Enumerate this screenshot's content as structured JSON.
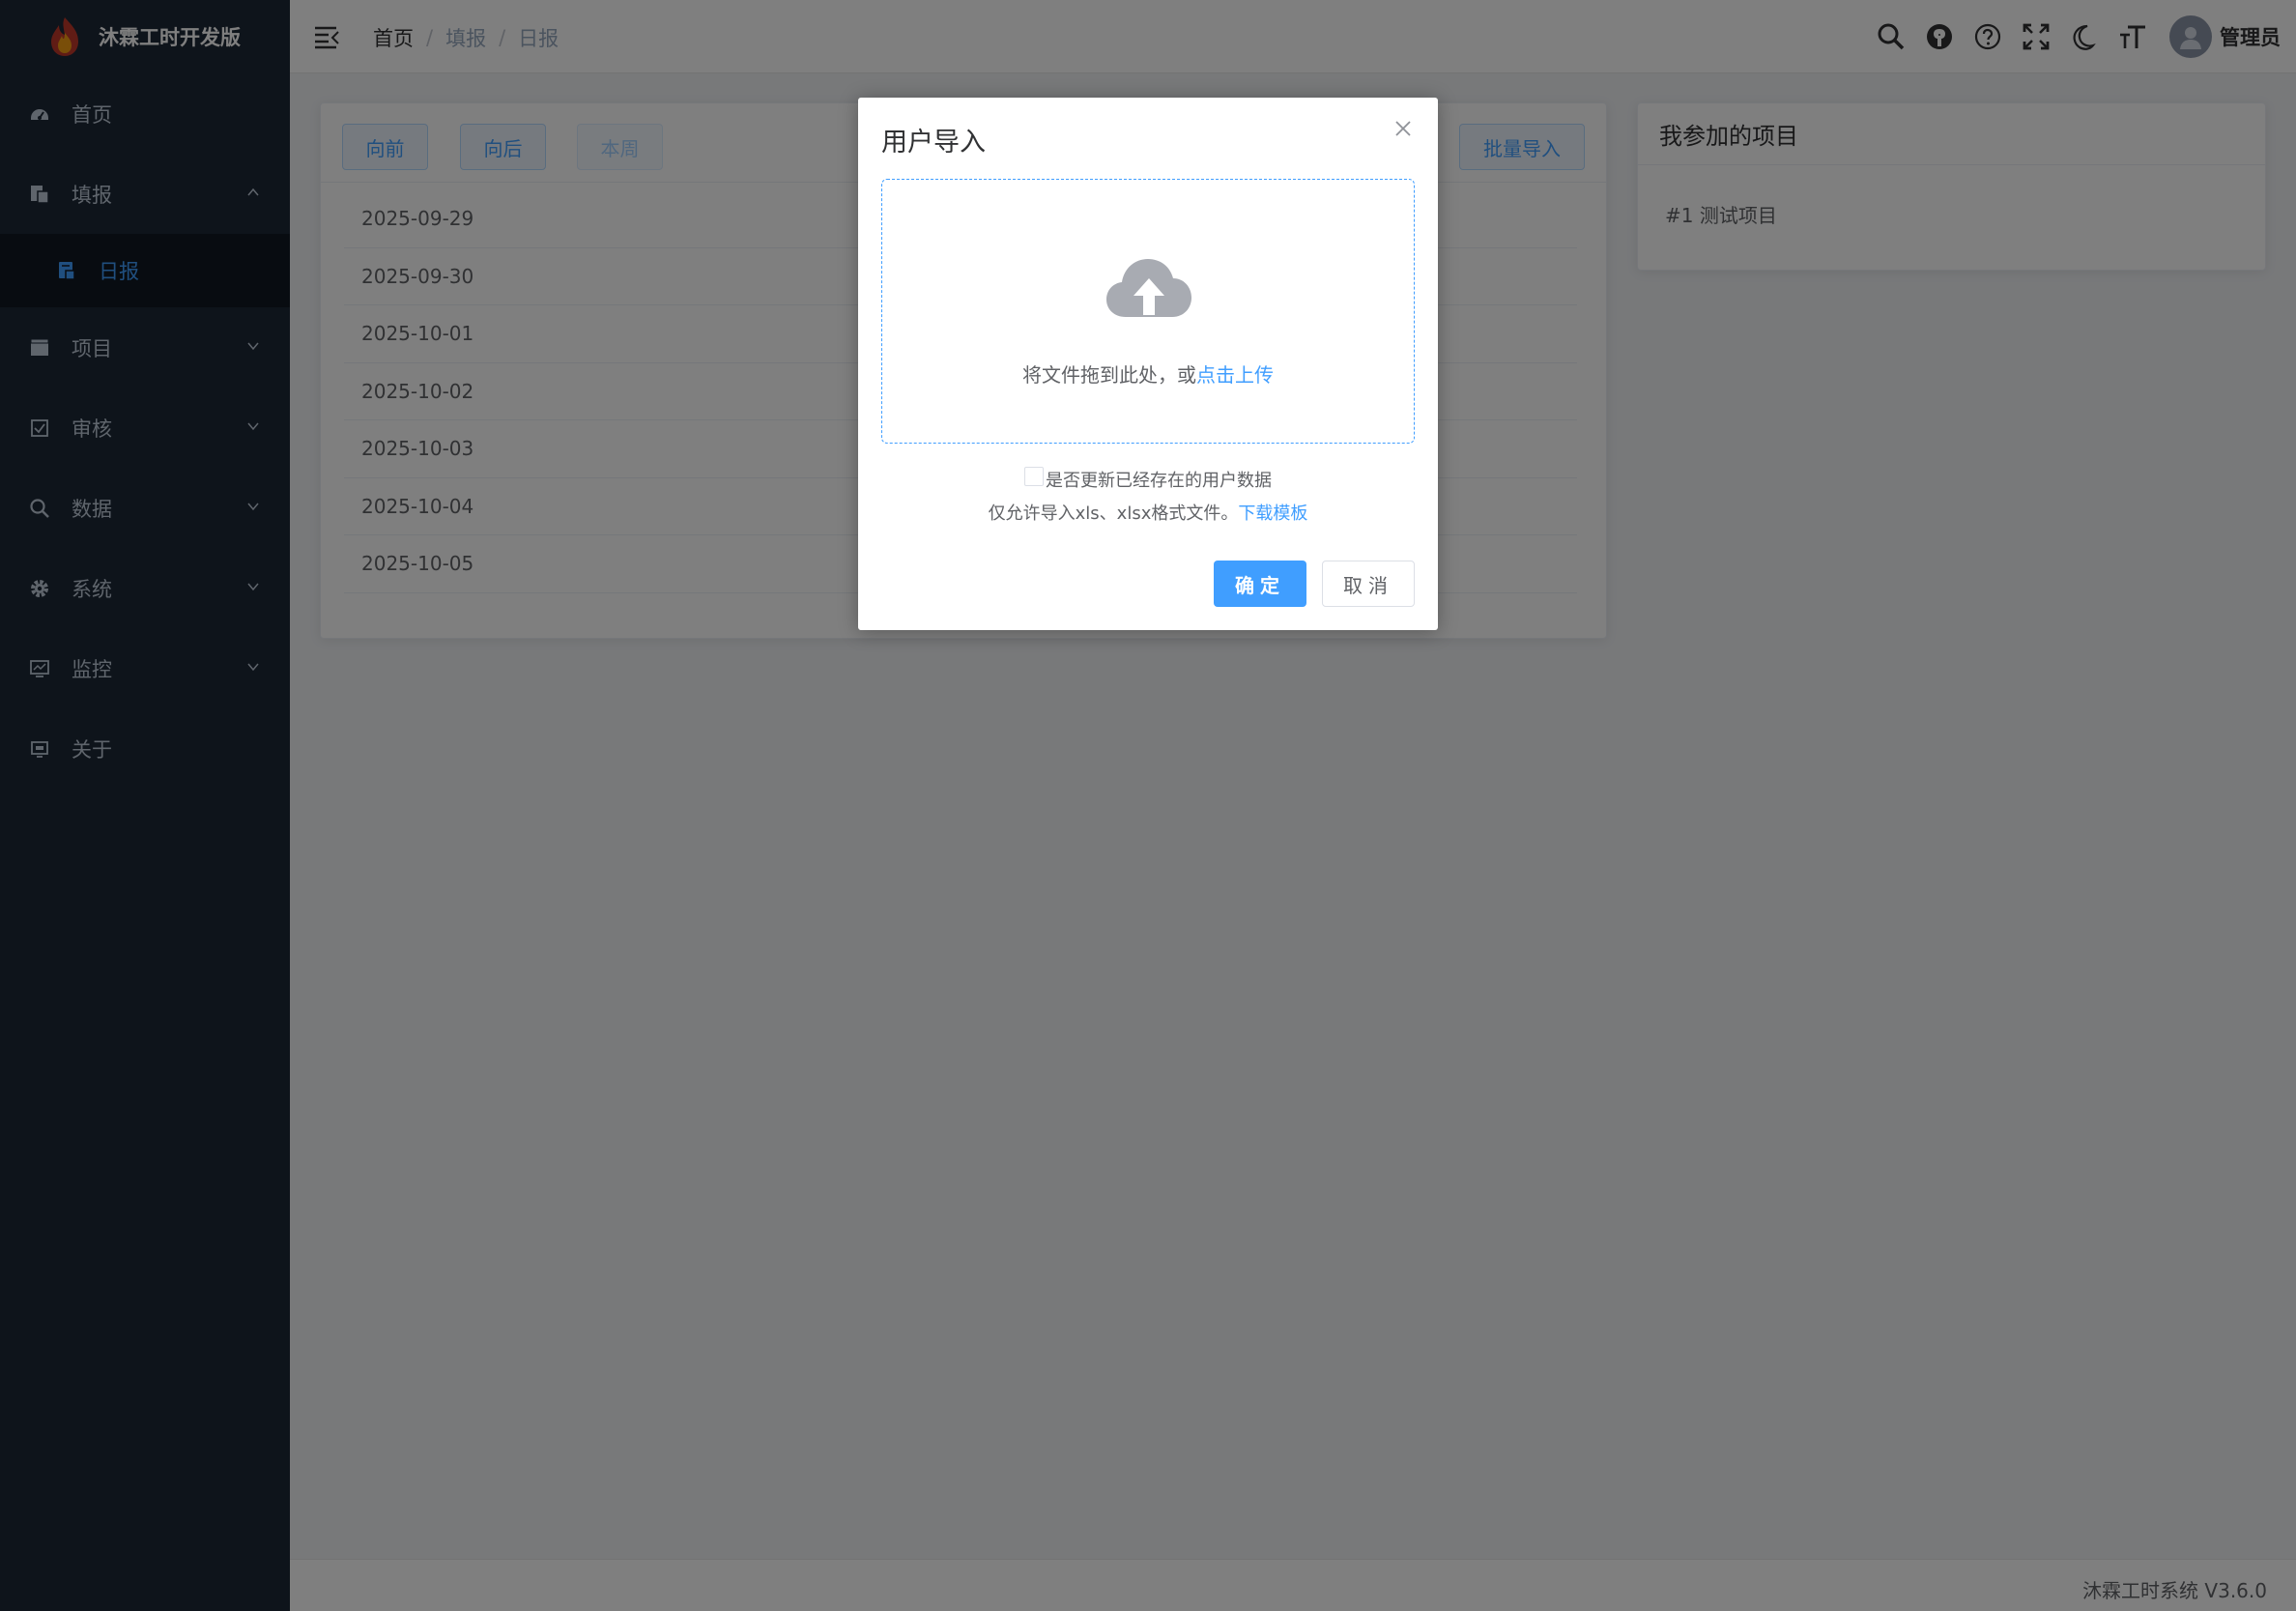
{
  "app": {
    "title": "沐霖工时开发版"
  },
  "sidebar": {
    "items": [
      {
        "label": "首页",
        "icon": "dashboard-icon"
      },
      {
        "label": "填报",
        "icon": "form-icon",
        "expanded": true,
        "children": [
          {
            "label": "日报",
            "icon": "report-icon",
            "active": true
          }
        ]
      },
      {
        "label": "项目",
        "icon": "project-icon"
      },
      {
        "label": "审核",
        "icon": "checkbox-icon"
      },
      {
        "label": "数据",
        "icon": "search-icon"
      },
      {
        "label": "系统",
        "icon": "gear-icon"
      },
      {
        "label": "监控",
        "icon": "monitor-icon"
      },
      {
        "label": "关于",
        "icon": "about-icon"
      }
    ]
  },
  "navbar": {
    "breadcrumb": [
      "首页",
      "填报",
      "日报"
    ],
    "username": "管理员"
  },
  "toolbar": {
    "prev_label": "向前",
    "next_label": "向后",
    "week_label": "本周",
    "batch_import_label": "批量导入"
  },
  "dates": [
    "2025-09-29",
    "2025-09-30",
    "2025-10-01",
    "2025-10-02",
    "2025-10-03",
    "2025-10-04",
    "2025-10-05"
  ],
  "my_projects": {
    "title": "我参加的项目",
    "items": [
      "#1 测试项目"
    ]
  },
  "footer": {
    "text": "沐霖工时系统 V3.6.0"
  },
  "dialog": {
    "title": "用户导入",
    "drop_text": "将文件拖到此处，或",
    "drop_link": "点击上传",
    "update_checkbox_label": "是否更新已经存在的用户数据",
    "tip_text": "仅允许导入xls、xlsx格式文件。",
    "tip_link": "下载模板",
    "confirm_label": "确定",
    "cancel_label": "取消"
  },
  "colors": {
    "primary": "#409eff",
    "sidebar_bg": "#1d2837",
    "sidebar_active_bg": "#101822"
  }
}
